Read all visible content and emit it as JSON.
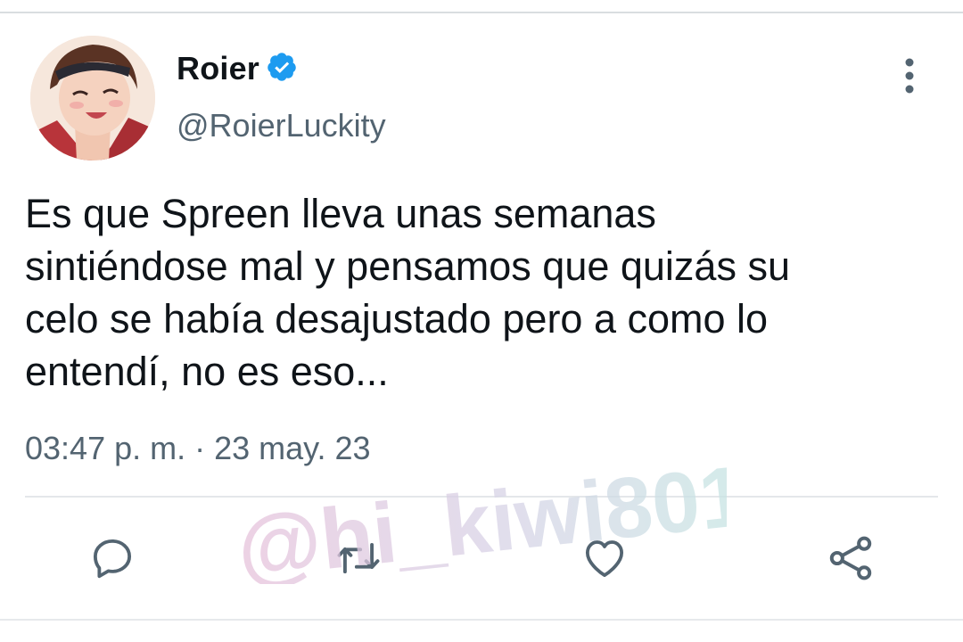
{
  "tweet": {
    "author_name": "Roier",
    "handle": "@RoierLuckity",
    "verified": true,
    "text_lines": [
      "Es que Spreen lleva unas semanas",
      "sintiéndose mal y pensamos que quizás su",
      "celo se había desajustado pero a como lo",
      "entendí, no es eso..."
    ],
    "timestamp": "03:47 p. m. · 23 may. 23"
  },
  "actions": {
    "reply_icon": "reply-icon",
    "retweet_icon": "retweet-icon",
    "like_icon": "heart-icon",
    "share_icon": "share-icon"
  },
  "watermark": {
    "text": "@hi_kiwi801"
  },
  "colors": {
    "text_primary": "#0f1419",
    "text_secondary": "#536471",
    "verified_blue": "#1d9bf0",
    "icon_gray": "#536471",
    "divider": "#e4e7ea"
  }
}
